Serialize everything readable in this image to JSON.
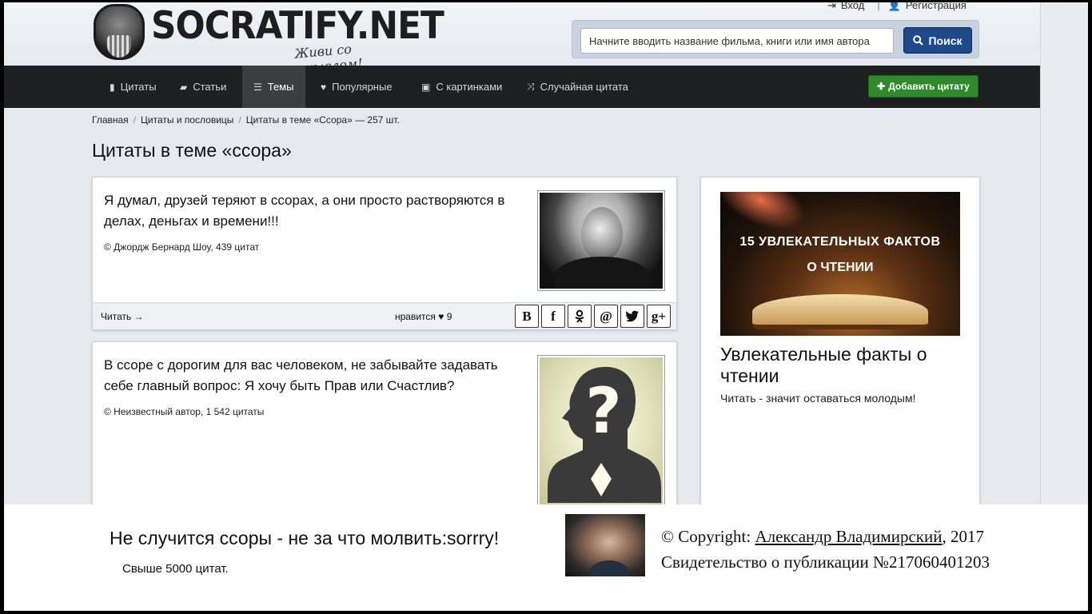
{
  "site": {
    "logo_text": "SOCRATIFY.NET",
    "slogan": "Живи со смыслом!",
    "login": "Вход",
    "register": "Регистрация"
  },
  "search": {
    "placeholder": "Начните вводить название фильма, книги или имя автора",
    "button": "Поиск"
  },
  "nav": {
    "items": [
      {
        "label": "Цитаты",
        "icon": "bookmark-icon"
      },
      {
        "label": "Статьи",
        "icon": "folder-open-icon"
      },
      {
        "label": "Темы",
        "icon": "list-icon",
        "active": true
      },
      {
        "label": "Популярные",
        "icon": "heart-icon"
      },
      {
        "label": "С картинками",
        "icon": "image-icon"
      },
      {
        "label": "Случайная цитата",
        "icon": "shuffle-icon"
      }
    ],
    "add_quote": "Добавить цитату"
  },
  "breadcrumb": [
    "Главная",
    "Цитаты и пословицы",
    "Цитаты в теме «Ссора» — 257 шт."
  ],
  "page_title": "Цитаты в теме «ссора»",
  "quotes": [
    {
      "text": "Я думал, друзей теряют в ссорах, а они просто растворяются в делах, деньгах и времени!!!",
      "author": "© Джордж Бернард Шоу, 439 цитат",
      "read": "Читать →",
      "likes_label": "нравится",
      "likes": "9"
    },
    {
      "text": "В ссоре с дорогим для вас человеком, не забывайте задавать себе главный вопрос: Я хочу быть Прав или Счастлив?",
      "author": "© Неизвестный автор, 1 542 цитаты"
    }
  ],
  "share_buttons": [
    "В",
    "f",
    "ok",
    "@",
    "twitter",
    "g+"
  ],
  "sidebar": {
    "promo_image_line1": "15 УВЛЕКАТЕЛЬНЫХ ФАКТОВ",
    "promo_image_line2": "О ЧТЕНИИ",
    "promo_title": "Увлекательные факты о чтении",
    "promo_subtitle": "Читать - значит оставаться молодым!"
  },
  "overlay": {
    "quote": "Не случится ссоры - не за что молвить:sorrry!",
    "count": "Свыше 5000 цитат.",
    "copyright_prefix": "© Copyright: ",
    "copyright_author": "Александр Владимирский",
    "copyright_year": ", 2017",
    "certificate": "Свидетельство о публикации №217060401203"
  },
  "colors": {
    "nav_bg": "#1e1f21",
    "search_button": "#1f4a8a",
    "add_button": "#2f8a2b",
    "page_bg": "#e6eaf0"
  }
}
